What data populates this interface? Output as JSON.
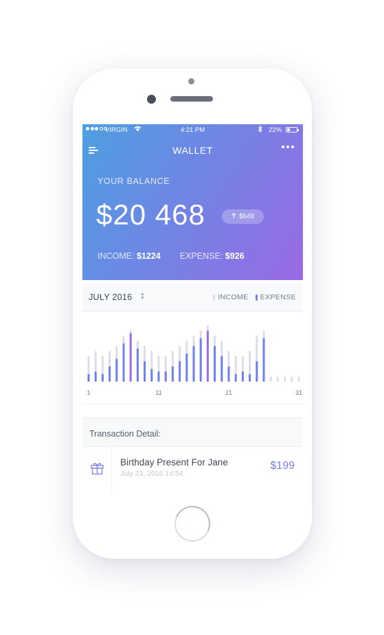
{
  "status": {
    "carrier": "VIRGIN",
    "time": "4:21 PM",
    "battery": "22%"
  },
  "header": {
    "title": "WALLET",
    "balance_label": "YOUR BALANCE",
    "balance_value": "$20 468",
    "change_badge": "$648",
    "income_label": "INCOME:",
    "income_value": "$1224",
    "expense_label": "EXPENSE:",
    "expense_value": "$926"
  },
  "chart_header": {
    "month": "JULY 2016",
    "legend_income": "INCOME",
    "legend_expense": "EXPENSE"
  },
  "colors": {
    "income": "#dcdde8",
    "expense": "#6e7ff0",
    "expense_peak": "#9b6de8",
    "amount": "#7b7fe6"
  },
  "chart_data": {
    "type": "bar",
    "x": [
      1,
      2,
      3,
      4,
      5,
      6,
      7,
      8,
      9,
      10,
      11,
      12,
      13,
      14,
      15,
      16,
      17,
      18,
      19,
      20,
      21,
      22,
      23,
      24,
      25,
      26,
      27,
      28,
      29,
      30,
      31
    ],
    "x_tick_labels": [
      "1",
      "11",
      "21",
      "31"
    ],
    "series": [
      {
        "name": "INCOME",
        "values": [
          5,
          6,
          5,
          6,
          7,
          9,
          10,
          8,
          7,
          6,
          5,
          5,
          6,
          7,
          8,
          9,
          10,
          11,
          9,
          8,
          6,
          5,
          5,
          6,
          9,
          10,
          1,
          1,
          1,
          1,
          1
        ]
      },
      {
        "name": "EXPENSE",
        "values": [
          1.5,
          2,
          1.5,
          3,
          4.5,
          7.5,
          9.5,
          6.5,
          4,
          2.5,
          2,
          2,
          3,
          4,
          5.5,
          7,
          8.5,
          10,
          7,
          5,
          3,
          1.5,
          2,
          1.5,
          4,
          8.5,
          0,
          0,
          0,
          0,
          0
        ]
      }
    ],
    "ylim": [
      0,
      11
    ]
  },
  "transactions": {
    "section_label": "Transaction Detail:",
    "items": [
      {
        "title": "Birthday Present For Jane",
        "date": "July 23, 2016  14:54",
        "amount": "$199",
        "icon": "gift-icon"
      }
    ]
  }
}
